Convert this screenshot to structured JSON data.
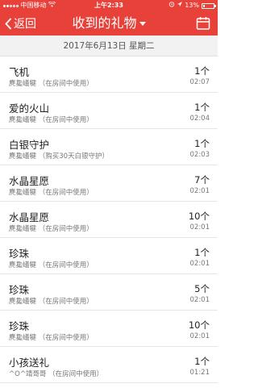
{
  "status_bar": {
    "carrier": "中国移动",
    "time": "上午2:33",
    "battery": "13%",
    "battery_level": 0.13,
    "signal_bars": 5,
    "signal_on": 2
  },
  "nav": {
    "back_label": "返回",
    "title": "收到的礼物"
  },
  "date_header": "2017年6月13日  星期二",
  "gifts": [
    {
      "name": "飞机",
      "sender": "麂毚嶬犍   （在房间中使用）",
      "qty": "1个",
      "time": "02:07"
    },
    {
      "name": "爱的火山",
      "sender": "麂毚嶬犍   （在房间中使用）",
      "qty": "1个",
      "time": "02:04"
    },
    {
      "name": "白银守护",
      "sender": "麂毚嶬犍   （购买30天白银守护）",
      "qty": "1个",
      "time": "02:03"
    },
    {
      "name": "水晶星愿",
      "sender": "麂毚嶬犍   （在房间中使用）",
      "qty": "7个",
      "time": "02:01"
    },
    {
      "name": "水晶星愿",
      "sender": "麂毚嶬犍   （在房间中使用）",
      "qty": "10个",
      "time": "02:01"
    },
    {
      "name": "珍珠",
      "sender": "麂毚嶬犍   （在房间中使用）",
      "qty": "1个",
      "time": "02:01"
    },
    {
      "name": "珍珠",
      "sender": "麂毚嶬犍   （在房间中使用）",
      "qty": "5个",
      "time": "02:01"
    },
    {
      "name": "珍珠",
      "sender": "麂毚嶬犍   （在房间中使用）",
      "qty": "10个",
      "time": "02:01"
    },
    {
      "name": "小孩送礼",
      "sender": "^O^靖哥哥   （在房间中使用）",
      "qty": "1个",
      "time": "01:21"
    }
  ],
  "colors": {
    "header_bg": "#e8413a",
    "date_bar_bg": "#f2f2f2"
  }
}
